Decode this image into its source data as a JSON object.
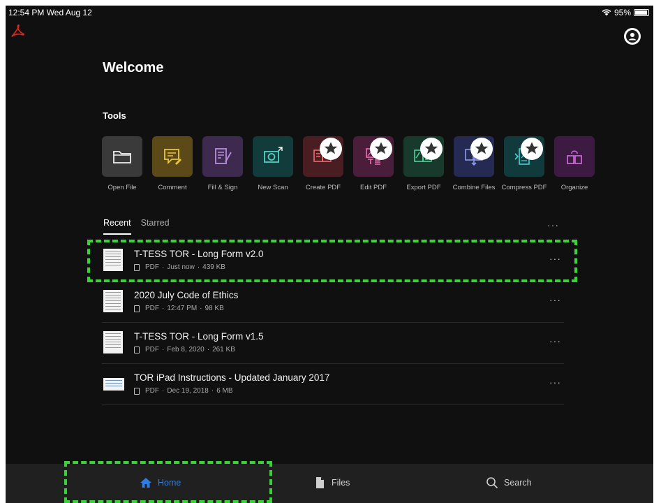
{
  "status_bar": {
    "time_date": "12:54 PM  Wed Aug 12",
    "battery": "95%"
  },
  "app": {
    "accent": "#2f7de1",
    "logo_color": "#e0261b"
  },
  "welcome": "Welcome",
  "tools_heading": "Tools",
  "tools": [
    {
      "label": "Open File",
      "icon": "folder-icon",
      "bg": "#3a3a3a",
      "fg": "#f0f0f0"
    },
    {
      "label": "Comment",
      "icon": "comment-icon",
      "bg": "#5b4a17",
      "fg": "#e9c640"
    },
    {
      "label": "Fill & Sign",
      "icon": "fill-sign-icon",
      "bg": "#3e2a4f",
      "fg": "#b78ddc"
    },
    {
      "label": "New Scan",
      "icon": "scan-camera-icon",
      "bg": "#123c3c",
      "fg": "#4fd1c5"
    },
    {
      "label": "Create PDF",
      "icon": "create-pdf-icon",
      "bg": "#4a1d22",
      "fg": "#f36b6b"
    },
    {
      "label": "Edit PDF",
      "icon": "edit-pdf-icon",
      "bg": "#4a1d3a",
      "fg": "#ef6fb5"
    },
    {
      "label": "Export PDF",
      "icon": "export-pdf-icon",
      "bg": "#173a2c",
      "fg": "#4fd39a"
    },
    {
      "label": "Combine Files",
      "icon": "combine-files-icon",
      "bg": "#252a52",
      "fg": "#8d9bf0"
    },
    {
      "label": "Compress PDF",
      "icon": "compress-pdf-icon",
      "bg": "#113a3c",
      "fg": "#45d2d6"
    },
    {
      "label": "Organize",
      "icon": "organize-icon",
      "bg": "#3d1a42",
      "fg": "#d46ee0"
    }
  ],
  "tabs": [
    {
      "label": "Recent"
    },
    {
      "label": "Starred"
    }
  ],
  "files": [
    {
      "name": "T-TESS TOR - Long Form v2.0",
      "type": "PDF",
      "date": "Just now",
      "size": "439 KB"
    },
    {
      "name": "2020 July Code of Ethics",
      "type": "PDF",
      "date": "12:47 PM",
      "size": "98 KB"
    },
    {
      "name": "T-TESS TOR - Long Form v1.5",
      "type": "PDF",
      "date": "Feb 8, 2020",
      "size": "261 KB"
    },
    {
      "name": "TOR iPad Instructions - Updated January 2017",
      "type": "PDF",
      "date": "Dec 19, 2018",
      "size": "6 MB"
    }
  ],
  "more_glyph": "···",
  "meta_separator": "·",
  "tabbar": {
    "home": "Home",
    "files": "Files",
    "search": "Search"
  }
}
